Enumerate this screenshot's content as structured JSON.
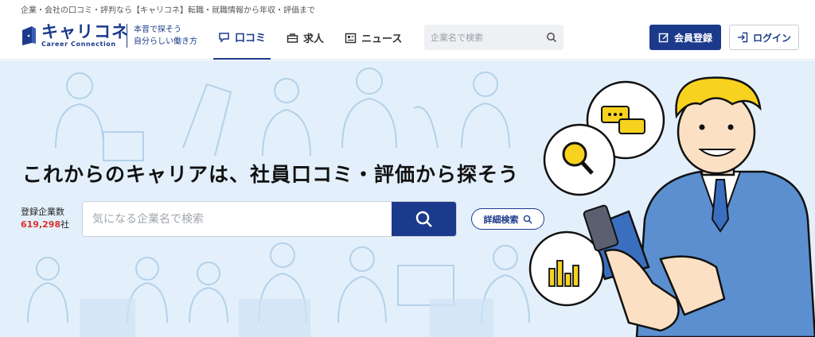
{
  "topline": "企業・会社の口コミ・評判なら【キャリコネ】転職・就職情報から年収・評価まで",
  "logo": {
    "title": "キャリコネ",
    "subtitle": "Career Connection"
  },
  "tagline": [
    "本音で探そう",
    "自分らしい働き方"
  ],
  "nav": [
    {
      "label": "口コミ",
      "icon": "chat-icon",
      "active": true
    },
    {
      "label": "求人",
      "icon": "briefcase-icon",
      "active": false
    },
    {
      "label": "ニュース",
      "icon": "news-icon",
      "active": false
    }
  ],
  "header_search": {
    "placeholder": "企業名で検索"
  },
  "buttons": {
    "register": "会員登録",
    "login": "ログイン"
  },
  "hero": {
    "title": "これからのキャリアは、社員口コミ・評価から探そう",
    "count_label": "登録企業数",
    "count_value": "619,298",
    "count_unit": "社",
    "search_placeholder": "気になる企業名で検索",
    "detail_search": "詳細検索"
  },
  "colors": {
    "brand": "#1c3a8c",
    "accent_red": "#d9312b",
    "hero_bg": "#e3f0fb",
    "bubble_yellow": "#f7d21e"
  }
}
